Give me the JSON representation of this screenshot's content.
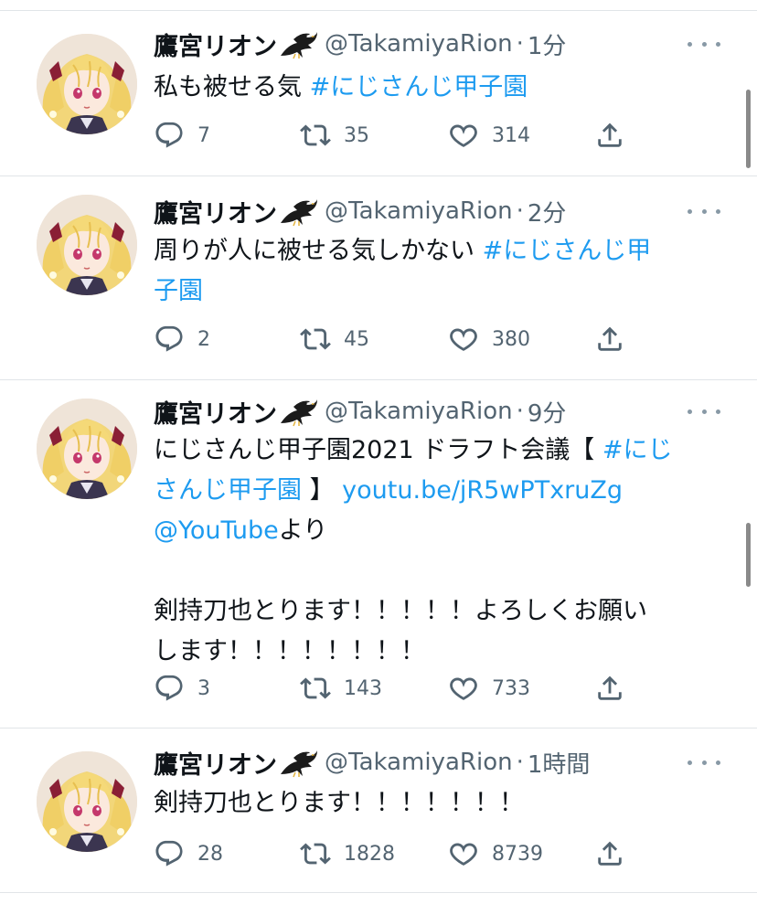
{
  "tweets": [
    {
      "name": "鷹宮リオン",
      "handle": "@TakamiyaRion",
      "separator": "·",
      "time": "1分",
      "lines": [
        [
          {
            "text": "私も被せる気 ",
            "link": false
          },
          {
            "text": "#にじさんじ甲子園",
            "link": true
          }
        ]
      ],
      "replies": "7",
      "retweets": "35",
      "likes": "314"
    },
    {
      "name": "鷹宮リオン",
      "handle": "@TakamiyaRion",
      "separator": "·",
      "time": "2分",
      "lines": [
        [
          {
            "text": "周りが人に被せる気しかない ",
            "link": false
          },
          {
            "text": "#にじさんじ甲",
            "link": true
          }
        ],
        [
          {
            "text": "子園",
            "link": true
          }
        ]
      ],
      "replies": "2",
      "retweets": "45",
      "likes": "380"
    },
    {
      "name": "鷹宮リオン",
      "handle": "@TakamiyaRion",
      "separator": "·",
      "time": "9分",
      "lines": [
        [
          {
            "text": "にじさんじ甲子園2021 ドラフト会議【 ",
            "link": false
          },
          {
            "text": "#にじ",
            "link": true
          }
        ],
        [
          {
            "text": "さんじ甲子園",
            "link": true
          },
          {
            "text": " 】 ",
            "link": false
          },
          {
            "text": "youtu.be/jR5wPTxruZg",
            "link": true
          }
        ],
        [
          {
            "text": "@YouTube",
            "link": true
          },
          {
            "text": "より",
            "link": false
          }
        ],
        [],
        [
          {
            "text": "剣持刀也とります！！！！！よろしくお願い",
            "link": false
          }
        ],
        [
          {
            "text": "します！！！！！！！！",
            "link": false
          }
        ]
      ],
      "replies": "3",
      "retweets": "143",
      "likes": "733"
    },
    {
      "name": "鷹宮リオン",
      "handle": "@TakamiyaRion",
      "separator": "·",
      "time": "1時間",
      "lines": [
        [
          {
            "text": "剣持刀也とります！！！！！！！",
            "link": false
          }
        ]
      ],
      "replies": "28",
      "retweets": "1828",
      "likes": "8739"
    }
  ],
  "icons": {
    "reply": "reply-icon",
    "retweet": "retweet-icon",
    "like": "heart-icon",
    "share": "share-icon",
    "more": "more-icon",
    "badge": "eagle-icon"
  },
  "colors": {
    "link": "#1d9bf0",
    "secondary_text": "#536471",
    "primary_text": "#0f1419",
    "divider": "#e1e5e8"
  }
}
